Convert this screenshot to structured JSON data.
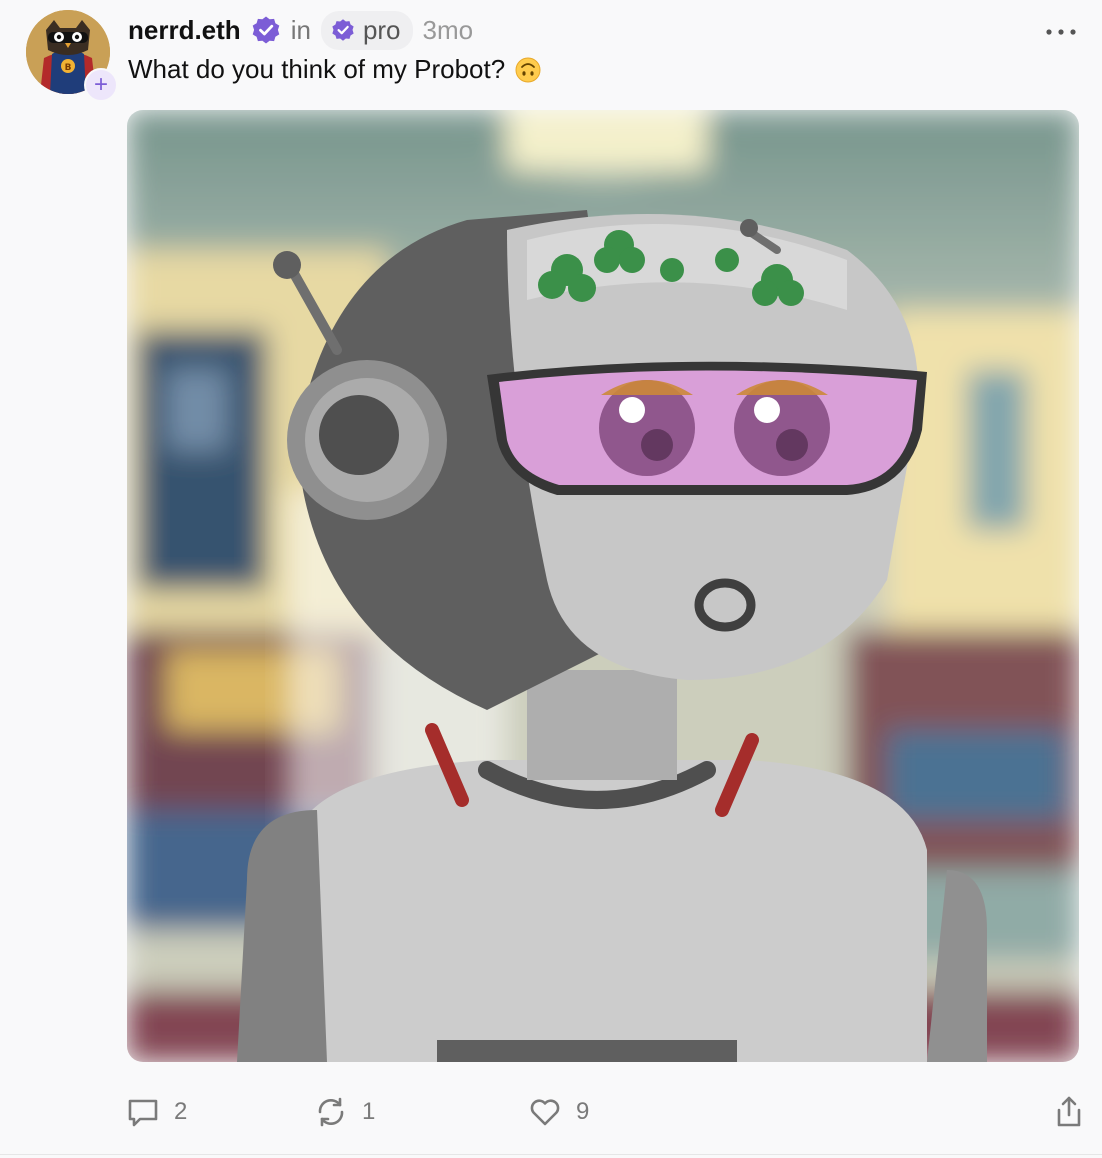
{
  "author": {
    "username": "nerrd.eth",
    "verified": true,
    "avatar_icon": "owl-superhero-avatar-icon",
    "follow_icon": "plus-icon"
  },
  "header": {
    "in_label": "in",
    "channel": "pro",
    "channel_icon": "verified-badge-icon",
    "time": "3mo",
    "more_icon": "ellipsis-icon"
  },
  "post": {
    "text": "What do you think of my Probot?",
    "emoji": "upside-down-face",
    "media_icon": "robot-image"
  },
  "actions": {
    "replies": "2",
    "recasts": "1",
    "likes": "9",
    "reply_icon": "comment-icon",
    "recast_icon": "recast-icon",
    "like_icon": "heart-icon",
    "share_icon": "share-icon"
  },
  "colors": {
    "accent": "#7c5dd6",
    "verified": "#7c5dd6",
    "muted": "#7a7a7a",
    "background": "#f9f9fa"
  }
}
